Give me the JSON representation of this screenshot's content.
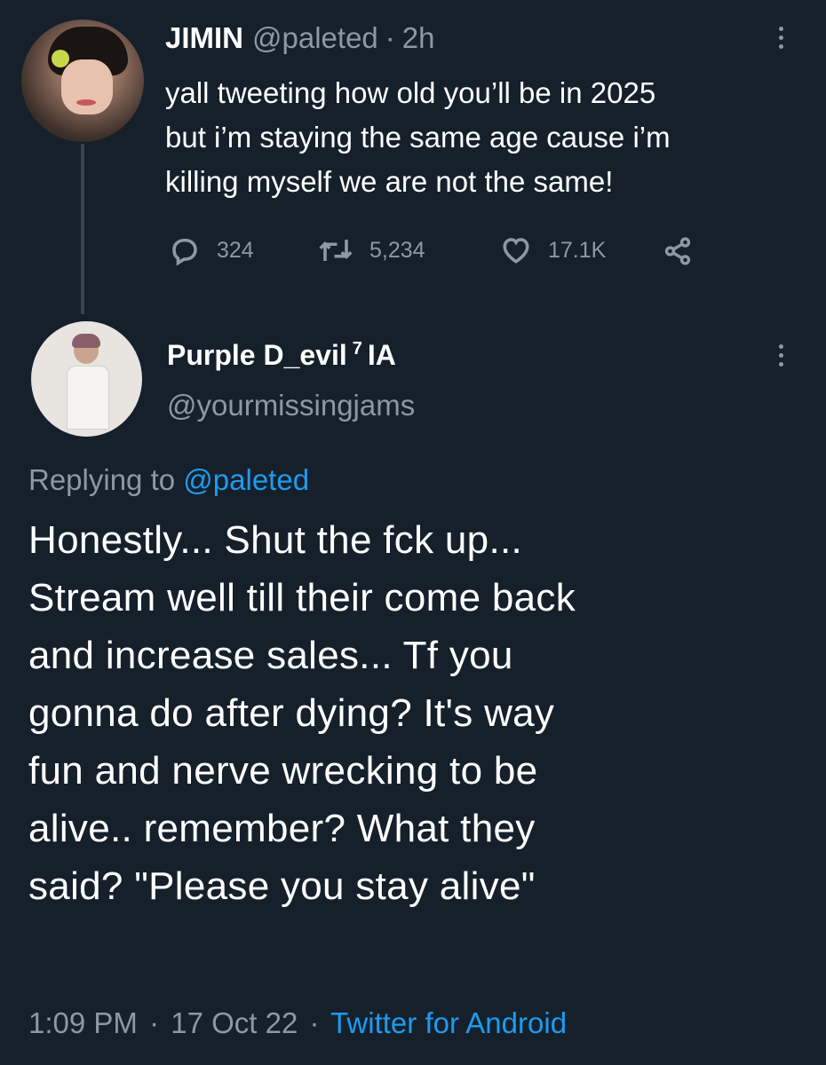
{
  "parent_tweet": {
    "display_name": "JIMIN",
    "handle": "@paleted",
    "separator": "·",
    "time_ago": "2h",
    "text": "yall tweeting how old you’ll be in 2025\nbut i’m staying the same age cause i’m\nkilling myself we are not the same!",
    "stats": {
      "replies": "324",
      "retweets": "5,234",
      "likes": "17.1K"
    }
  },
  "reply_tweet": {
    "display_name": "Purple D_evil",
    "superscript": "7",
    "name_suffix": "IA",
    "handle": "@yourmissingjams",
    "replying_prefix": "Replying to",
    "replying_handle": "@paleted",
    "text": "Honestly... Shut the fck up...\nStream well till their come back\nand increase sales...  Tf you\ngonna do after dying? It's way\nfun and nerve wrecking to be\nalive.. remember? What they\nsaid? \"Please you stay alive\"",
    "time": "1:09 PM",
    "separator": "·",
    "date": "17 Oct 22",
    "source": "Twitter for Android"
  },
  "colors": {
    "background": "#15202b",
    "text_primary": "#ffffff",
    "text_secondary": "#8b98a5",
    "link": "#1d9bf0",
    "thread_line": "#38444d"
  },
  "icons": [
    "reply-icon",
    "retweet-icon",
    "like-icon",
    "share-icon",
    "more-options-icon"
  ]
}
